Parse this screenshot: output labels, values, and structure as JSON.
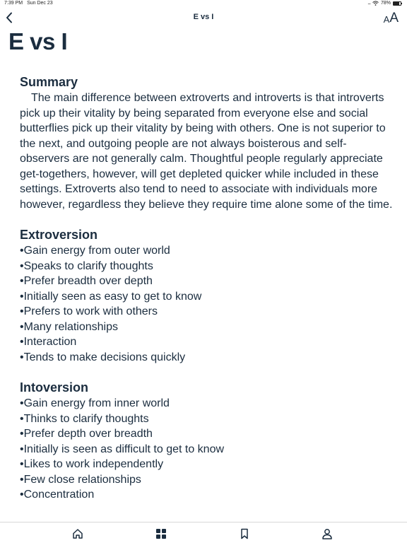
{
  "status_bar": {
    "time": "7:39 PM",
    "date": "Sun Dec 23",
    "battery_percent": "78%",
    "battery_level": 0.78
  },
  "nav": {
    "title": "E vs I",
    "text_size_small": "A",
    "text_size_large": "A"
  },
  "page_title": "E vs I",
  "summary": {
    "heading": "Summary",
    "text": "The main difference between extroverts and introverts is that introverts pick up their vitality by being separated from everyone else and social butterflies pick up their vitality by being with others. One is not superior to the next, and outgoing people are not always boisterous and self-observers are not generally calm. Thoughtful people regularly appreciate get-togethers, however, will get depleted quicker while included in these settings. Extroverts also tend to need to associate with individuals more however, regardless they believe they require time alone some of the time."
  },
  "extroversion": {
    "heading": "Extroversion",
    "items": [
      "Gain energy from outer world",
      "Speaks to clarify thoughts",
      "Prefer breadth over depth",
      "Initially seen as easy to get to know",
      "Prefers to work with others",
      "Many relationships",
      "Interaction",
      "Tends to make decisions quickly"
    ]
  },
  "introversion": {
    "heading": "Intoversion",
    "items": [
      "Gain energy from inner world",
      "Thinks to clarify thoughts",
      "Prefer depth over breadth",
      "Initially is seen as difficult to get to know",
      "Likes to work independently",
      "Few close relationships",
      "Concentration"
    ]
  },
  "tabs": [
    {
      "icon": "home-icon"
    },
    {
      "icon": "grid-icon"
    },
    {
      "icon": "bookmark-icon"
    },
    {
      "icon": "person-icon"
    }
  ],
  "colors": {
    "text": "#1b2d3f",
    "background": "#ffffff"
  }
}
